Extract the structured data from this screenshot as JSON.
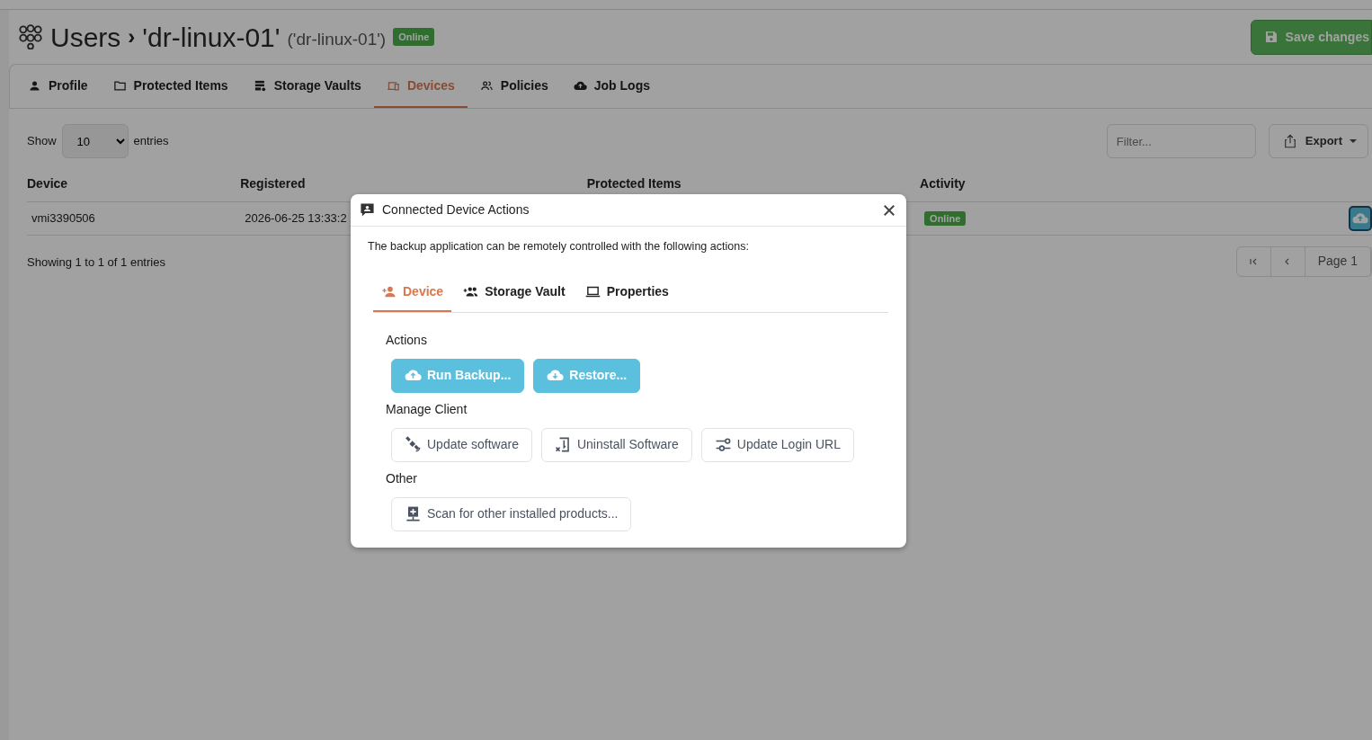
{
  "header": {
    "root": "Users",
    "separator": "›",
    "title": "'dr-linux-01'",
    "subtitle": "('dr-linux-01')",
    "status": "Online",
    "save_button": "Save changes"
  },
  "tabs": [
    {
      "label": "Profile",
      "selected": false
    },
    {
      "label": "Protected Items",
      "selected": false
    },
    {
      "label": "Storage Vaults",
      "selected": false
    },
    {
      "label": "Devices",
      "selected": true
    },
    {
      "label": "Policies",
      "selected": false
    },
    {
      "label": "Job Logs",
      "selected": false
    }
  ],
  "table_controls": {
    "show_label": "Show",
    "page_size": "10",
    "entries_label": "entries",
    "filter_placeholder": "Filter...",
    "export_button": "Export"
  },
  "table": {
    "columns": [
      "Device",
      "Registered",
      "Protected Items",
      "Activity"
    ],
    "rows": [
      {
        "device": "vmi3390506",
        "registered": "2026-06-25 13:33:2",
        "activity": "Online"
      }
    ]
  },
  "table_info": "Showing 1 to 1 of 1 entries",
  "pagination": {
    "page": "Page 1"
  },
  "modal": {
    "title": "Connected Device Actions",
    "description": "The backup application can be remotely controlled with the following actions:",
    "tabs": [
      {
        "label": "Device",
        "selected": true
      },
      {
        "label": "Storage Vault",
        "selected": false
      },
      {
        "label": "Properties",
        "selected": false
      }
    ],
    "sections": [
      {
        "title": "Actions",
        "buttons": [
          {
            "label": "Run Backup...",
            "kind": "primary"
          },
          {
            "label": "Restore...",
            "kind": "primary"
          }
        ]
      },
      {
        "title": "Manage Client",
        "buttons": [
          {
            "label": "Update software",
            "kind": "outline"
          },
          {
            "label": "Uninstall Software",
            "kind": "outline"
          },
          {
            "label": "Update Login URL",
            "kind": "outline"
          }
        ]
      },
      {
        "title": "Other",
        "buttons": [
          {
            "label": "Scan for other installed products...",
            "kind": "outline"
          }
        ]
      }
    ]
  }
}
